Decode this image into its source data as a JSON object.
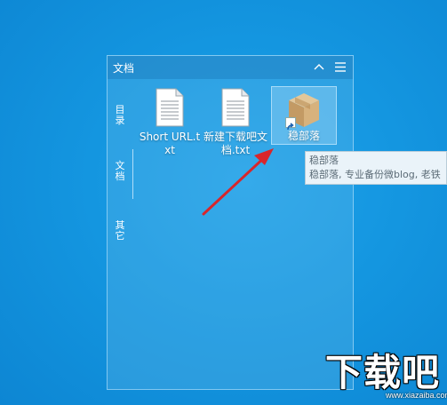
{
  "fence": {
    "title": "文档",
    "collapse_icon": "chevron-up-icon",
    "menu_icon": "menu-icon",
    "tabs": [
      {
        "label": "目录"
      },
      {
        "label": "文档"
      },
      {
        "label": "其它"
      }
    ],
    "items": [
      {
        "label": "Short URL.txt",
        "icon": "text-document-icon"
      },
      {
        "label": "新建下载吧文档.txt",
        "icon": "text-document-icon"
      },
      {
        "label": "稳部落",
        "icon": "package-box-icon",
        "shortcut": true
      }
    ]
  },
  "tooltip": {
    "line1": "稳部落",
    "line2": "稳部落, 专业备份微blog, 老铁"
  },
  "watermark": {
    "text": "下载吧",
    "url": "www.xiazaiba.com"
  },
  "colors": {
    "desktop": "#1496e0",
    "arrow": "#d8262b"
  }
}
